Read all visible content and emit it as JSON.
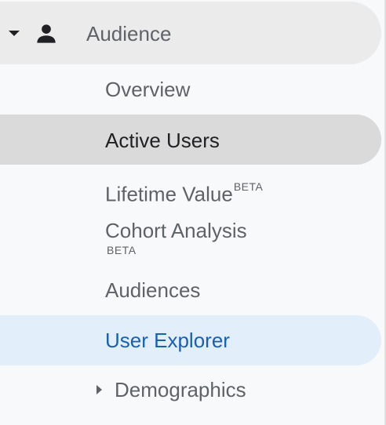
{
  "section": {
    "label": "Audience",
    "expanded": true,
    "icon": "person-icon"
  },
  "items": [
    {
      "label": "Overview",
      "state": "normal"
    },
    {
      "label": "Active Users",
      "state": "hover"
    },
    {
      "label": "Lifetime Value",
      "badge": "BETA",
      "state": "normal"
    },
    {
      "label": "Cohort Analysis",
      "badge": "BETA",
      "state": "normal"
    },
    {
      "label": "Audiences",
      "state": "normal"
    },
    {
      "label": "User Explorer",
      "state": "selected"
    },
    {
      "label": "Demographics",
      "state": "collapsed-group"
    }
  ],
  "colors": {
    "text": "#5f6368",
    "selected_text": "#1a5fb4",
    "selected_bg": "#e3eefb",
    "hover_bg": "#dadada",
    "section_bg": "#ebebeb"
  }
}
